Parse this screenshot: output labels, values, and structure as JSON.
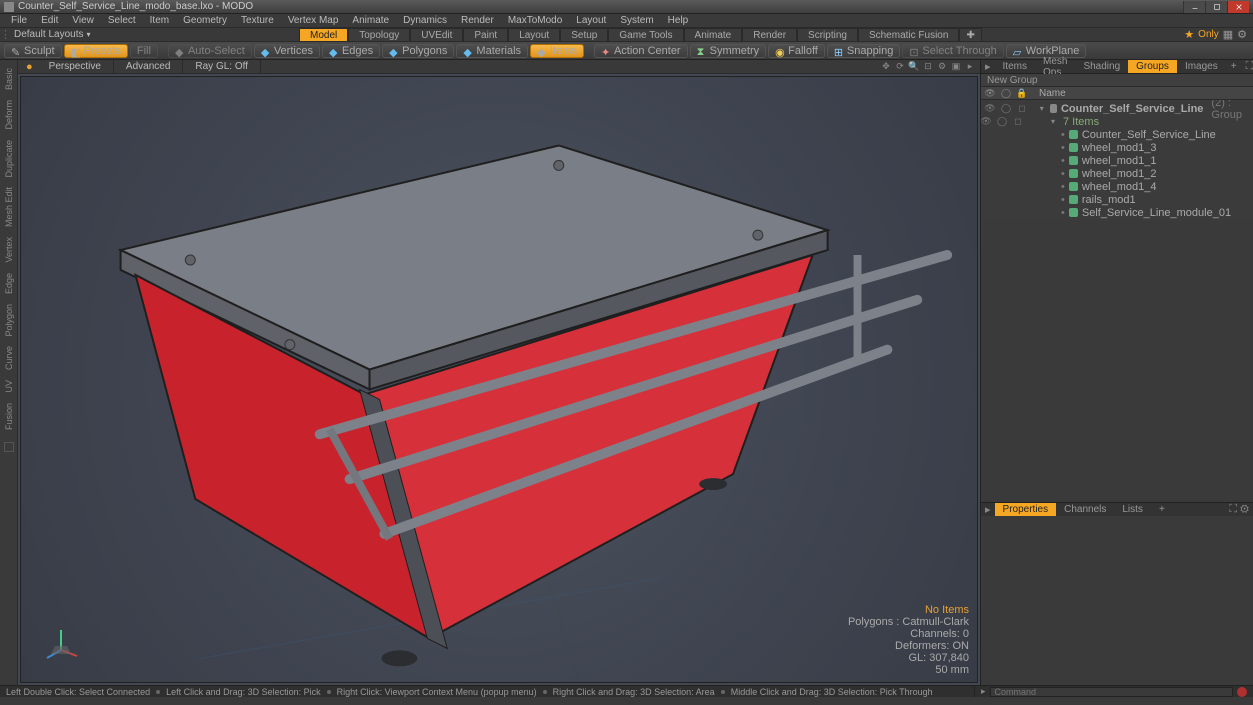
{
  "titlebar": {
    "title": "Counter_Self_Service_Line_modo_base.lxo - MODO"
  },
  "menu": [
    "File",
    "Edit",
    "View",
    "Select",
    "Item",
    "Geometry",
    "Texture",
    "Vertex Map",
    "Animate",
    "Dynamics",
    "Render",
    "MaxToModo",
    "Layout",
    "System",
    "Help"
  ],
  "layoutbar": {
    "dropdown": "Default Layouts",
    "tabs": [
      "Model",
      "Topology",
      "UVEdit",
      "Paint",
      "Layout",
      "Setup",
      "Game Tools",
      "Animate",
      "Render",
      "Scripting",
      "Schematic Fusion"
    ],
    "active": "Model",
    "only": "Only"
  },
  "toolbar": {
    "sculpt": "Sculpt",
    "presets": "Presets",
    "fill": "Fill",
    "auto_select": "Auto-Select",
    "vertices": "Vertices",
    "edges": "Edges",
    "polygons": "Polygons",
    "materials": "Materials",
    "items": "Items",
    "action_center": "Action Center",
    "symmetry": "Symmetry",
    "falloff": "Falloff",
    "snapping": "Snapping",
    "select_through": "Select Through",
    "workplane": "WorkPlane"
  },
  "leftstrip": [
    "Basic",
    "Deform",
    "Duplicate",
    "Mesh Edit",
    "Vertex",
    "Edge",
    "Polygon",
    "Curve",
    "UV",
    "Fusion"
  ],
  "viewport_tabs": {
    "persp": "Perspective",
    "adv": "Advanced",
    "ray": "Ray GL: Off"
  },
  "viewport_stats": {
    "noitems": "No Items",
    "polygons": "Polygons : Catmull-Clark",
    "channels": "Channels: 0",
    "deformers": "Deformers: ON",
    "gl": "GL: 307,840",
    "unit": "50 mm"
  },
  "right": {
    "tabs_top": [
      "Items",
      "Mesh Ops",
      "Shading",
      "Groups",
      "Images"
    ],
    "tabs_top_active": "Groups",
    "newgroup": "New Group",
    "header_name": "Name",
    "tree": {
      "root": {
        "label": "Counter_Self_Service_Line",
        "suffix": "(2) : Group"
      },
      "count": "7 Items",
      "children": [
        "Counter_Self_Service_Line",
        "wheel_mod1_3",
        "wheel_mod1_1",
        "wheel_mod1_2",
        "wheel_mod1_4",
        "rails_mod1",
        "Self_Service_Line_module_01"
      ]
    },
    "tabs_bottom": [
      "Properties",
      "Channels",
      "Lists"
    ],
    "tabs_bottom_active": "Properties"
  },
  "status": {
    "hints": [
      "Left Double Click: Select Connected",
      "Left Click and Drag: 3D Selection: Pick",
      "Right Click: Viewport Context Menu (popup menu)",
      "Right Click and Drag: 3D Selection: Area",
      "Middle Click and Drag: 3D Selection: Pick Through"
    ],
    "command": "Command"
  }
}
